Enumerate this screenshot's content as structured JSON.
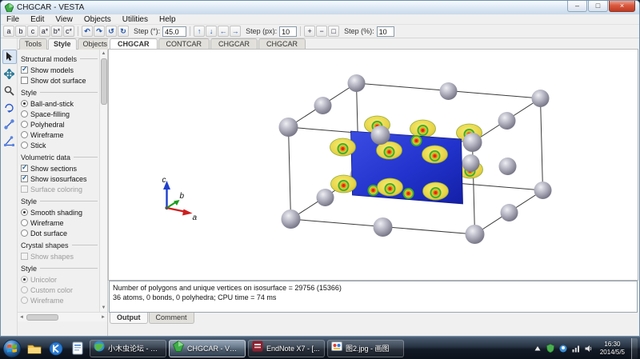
{
  "window": {
    "title": "CHGCAR - VESTA",
    "minimize": "–",
    "maximize": "□",
    "close": "×"
  },
  "menubar": {
    "items": [
      "File",
      "Edit",
      "View",
      "Objects",
      "Utilities",
      "Help"
    ]
  },
  "toolbar": {
    "axis_buttons": [
      "a",
      "b",
      "c",
      "a*",
      "b*",
      "c*"
    ],
    "rotate_buttons": [
      "↶",
      "↷",
      "↺",
      "↻"
    ],
    "step_deg_label": "Step (°):",
    "step_deg_value": "45.0",
    "pan_buttons": [
      "↑",
      "↓",
      "←",
      "→"
    ],
    "step_px_label": "Step (px):",
    "step_px_value": "10",
    "zoom_in": "+",
    "zoom_out": "−",
    "fit": "□",
    "step_pct_label": "Step (%):",
    "step_pct_value": "10"
  },
  "tool_strip": {
    "tools": [
      "select",
      "pan",
      "zoom",
      "rotate",
      "distance",
      "angle"
    ]
  },
  "sidebar": {
    "tabs": [
      "Tools",
      "Style",
      "Objects"
    ],
    "active_tab": "Style",
    "rows": [
      {
        "type": "header",
        "label": "Structural models"
      },
      {
        "type": "checkbox",
        "label": "Show models",
        "checked": true
      },
      {
        "type": "checkbox",
        "label": "Show dot surface",
        "checked": false
      },
      {
        "type": "header",
        "label": "Style"
      },
      {
        "type": "radio",
        "label": "Ball-and-stick",
        "checked": true
      },
      {
        "type": "radio",
        "label": "Space-filling",
        "checked": false
      },
      {
        "type": "radio",
        "label": "Polyhedral",
        "checked": false
      },
      {
        "type": "radio",
        "label": "Wireframe",
        "checked": false
      },
      {
        "type": "radio",
        "label": "Stick",
        "checked": false
      },
      {
        "type": "header",
        "label": "Volumetric data"
      },
      {
        "type": "checkbox",
        "label": "Show sections",
        "checked": true
      },
      {
        "type": "checkbox",
        "label": "Show isosurfaces",
        "checked": true
      },
      {
        "type": "checkbox",
        "label": "Surface coloring",
        "checked": false,
        "disabled": true
      },
      {
        "type": "header",
        "label": "Style"
      },
      {
        "type": "radio",
        "label": "Smooth shading",
        "checked": true
      },
      {
        "type": "radio",
        "label": "Wireframe",
        "checked": false
      },
      {
        "type": "radio",
        "label": "Dot surface",
        "checked": false
      },
      {
        "type": "header",
        "label": "Crystal shapes"
      },
      {
        "type": "checkbox",
        "label": "Show shapes",
        "checked": false,
        "disabled": true
      },
      {
        "type": "header",
        "label": "Style"
      },
      {
        "type": "radio",
        "label": "Unicolor",
        "checked": true,
        "disabled": true
      },
      {
        "type": "radio",
        "label": "Custom color",
        "checked": false,
        "disabled": true
      },
      {
        "type": "radio",
        "label": "Wireframe",
        "checked": false,
        "disabled": true
      }
    ]
  },
  "main": {
    "tabs": [
      "CHGCAR",
      "CONTCAR",
      "CHGCAR",
      "CHGCAR"
    ],
    "active_tab_index": 0,
    "axes": {
      "a": "a",
      "b": "b",
      "c": "c"
    }
  },
  "output": {
    "lines": [
      "Number of polygons and unique vertices on isosurface = 29756 (15366)",
      "36 atoms, 0 bonds, 0 polyhedra; CPU time = 74 ms"
    ],
    "tabs": [
      "Output",
      "Comment"
    ],
    "active_tab": "Output"
  },
  "taskbar": {
    "buttons": [
      {
        "label": "小木虫论坛 - 学...",
        "active": false
      },
      {
        "label": "CHGCAR - VESTA",
        "active": true
      },
      {
        "label": "EndNote X7 - [...",
        "active": false
      },
      {
        "label": "图2.jpg - 画图",
        "active": false
      }
    ],
    "clock": {
      "time": "16:30",
      "date": "2014/5/5"
    }
  },
  "colors": {
    "section_plane": "#2035cc",
    "isosurface": "#e8d84a",
    "atoms": "#9a99a8",
    "axis_a": "#cc2020",
    "axis_b": "#1f9c1f",
    "axis_c": "#2040cc"
  }
}
